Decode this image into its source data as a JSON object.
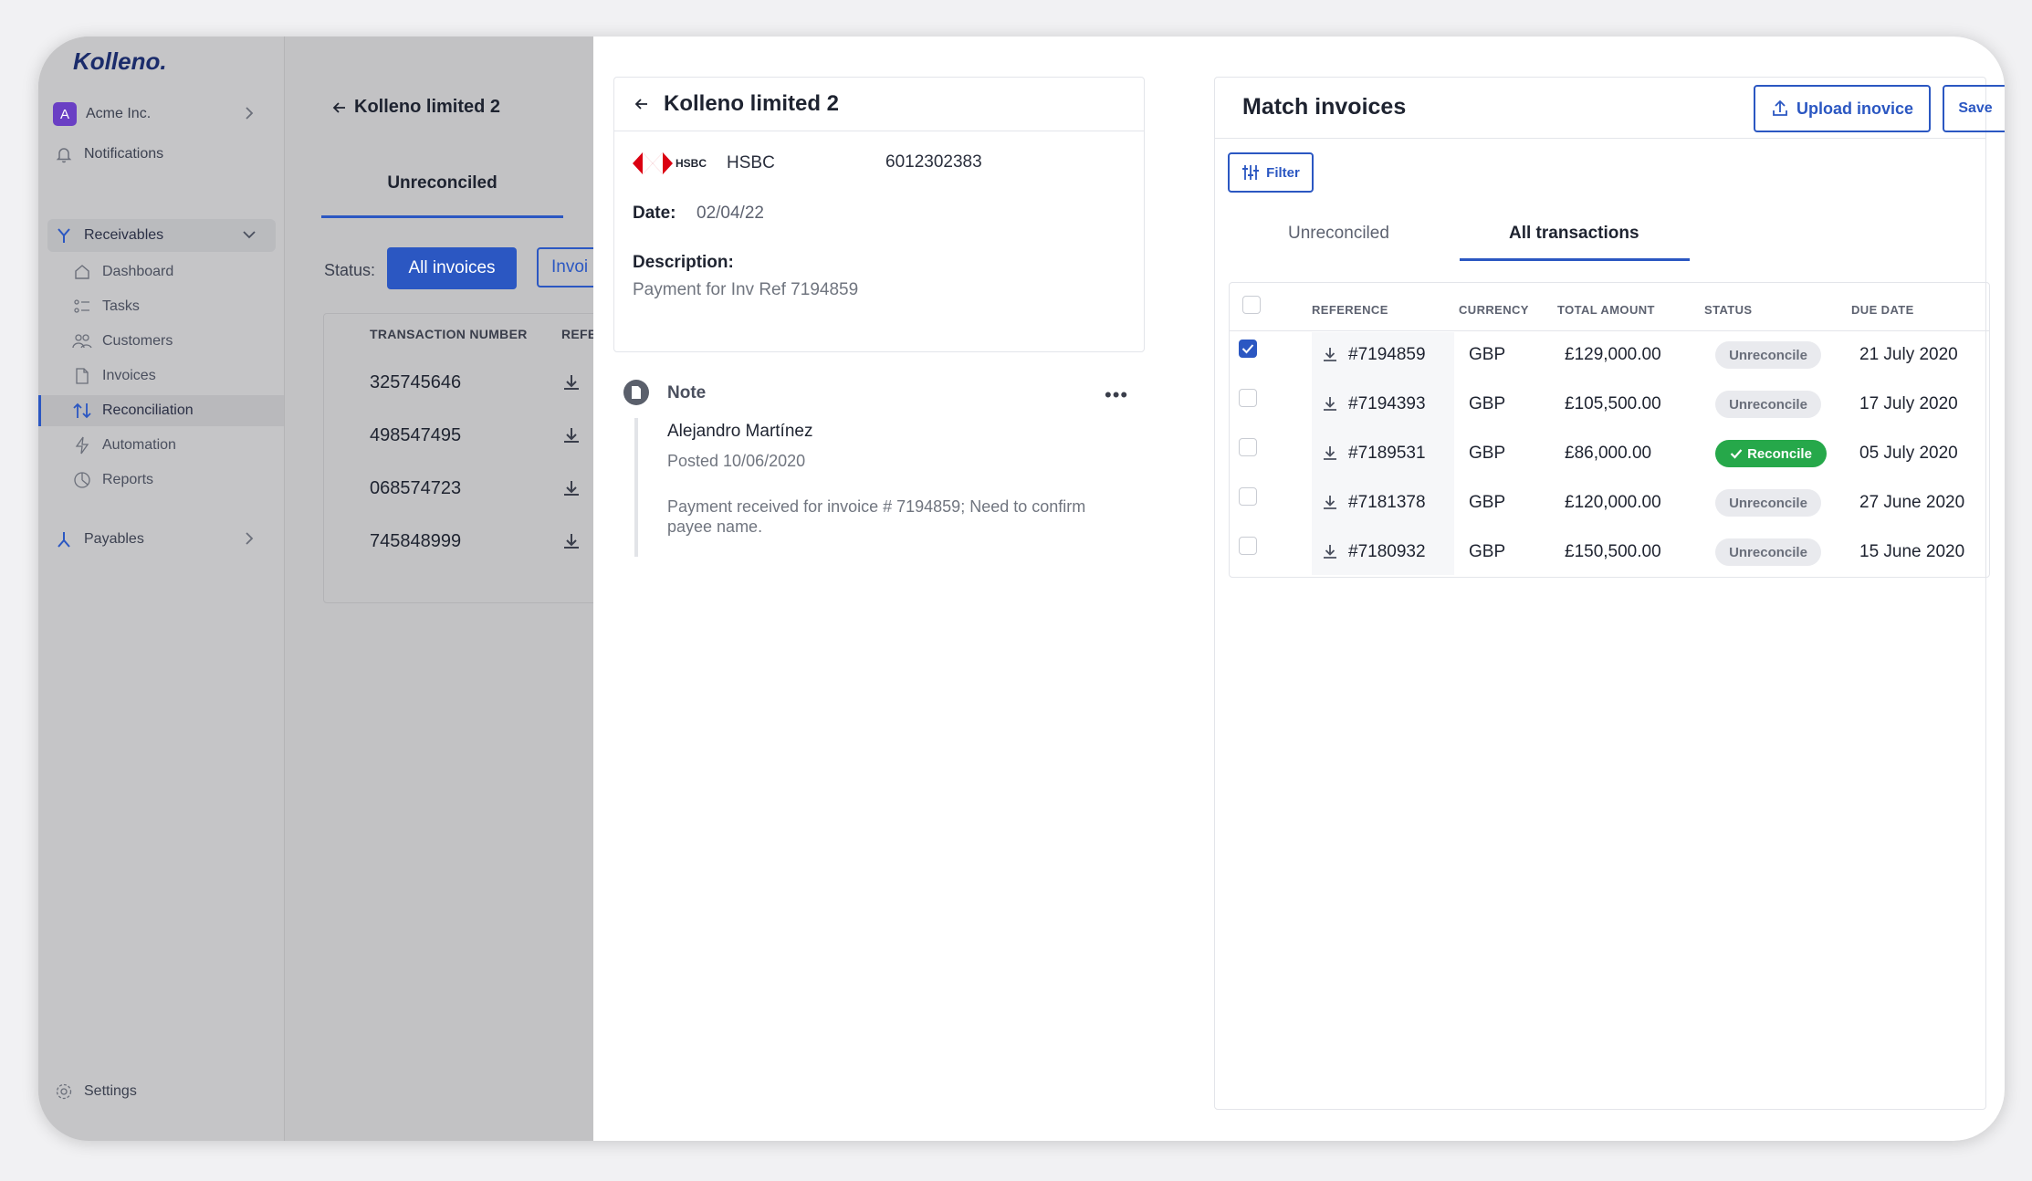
{
  "app": {
    "logo": "Kolleno."
  },
  "sidebar": {
    "org": {
      "badge": "A",
      "name": "Acme Inc."
    },
    "notifications": "Notifications",
    "receivables": {
      "label": "Receivables",
      "items": [
        "Dashboard",
        "Tasks",
        "Customers",
        "Invoices",
        "Reconciliation",
        "Automation",
        "Reports"
      ],
      "active": "Reconciliation"
    },
    "payables": "Payables",
    "settings": "Settings"
  },
  "background_view": {
    "title": "Kolleno limited 2",
    "tab": "Unreconciled",
    "status_label": "Status:",
    "filter_all": "All invoices",
    "filter_second": "Invoi",
    "columns": [
      "TRANSACTION NUMBER",
      "REFE"
    ],
    "rows": [
      "325745646",
      "498547495",
      "068574723",
      "745848999"
    ]
  },
  "transaction": {
    "title": "Kolleno limited 2",
    "bank_logo_text": "HSBC",
    "bank_name": "HSBC",
    "account_number": "6012302383",
    "date_label": "Date:",
    "date_value": "02/04/22",
    "description_label": "Description:",
    "description_value": "Payment for Inv Ref 7194859"
  },
  "note": {
    "label": "Note",
    "menu": "•••",
    "author": "Alejandro Martínez",
    "posted": "Posted 10/06/2020",
    "text": "Payment received for invoice # 7194859; Need to confirm payee name."
  },
  "match": {
    "title": "Match invoices",
    "upload_label": "Upload inovice",
    "save_label": "Save",
    "filter_label": "Filter",
    "tabs": [
      "Unreconciled",
      "All transactions"
    ],
    "active_tab": "All transactions",
    "columns": [
      "REFERENCE",
      "CURRENCY",
      "TOTAL AMOUNT",
      "STATUS",
      "DUE DATE"
    ],
    "rows": [
      {
        "checked": true,
        "reference": "#7194859",
        "currency": "GBP",
        "amount": "£129,000.00",
        "status": "Unreconcile",
        "due": "21 July 2020"
      },
      {
        "checked": false,
        "reference": "#7194393",
        "currency": "GBP",
        "amount": "£105,500.00",
        "status": "Unreconcile",
        "due": "17 July 2020"
      },
      {
        "checked": false,
        "reference": "#7189531",
        "currency": "GBP",
        "amount": "£86,000.00",
        "status": "Reconcile",
        "due": "05 July 2020"
      },
      {
        "checked": false,
        "reference": "#7181378",
        "currency": "GBP",
        "amount": "£120,000.00",
        "status": "Unreconcile",
        "due": "27 June 2020"
      },
      {
        "checked": false,
        "reference": "#7180932",
        "currency": "GBP",
        "amount": "£150,500.00",
        "status": "Unreconcile",
        "due": "15 June 2020"
      }
    ]
  },
  "colors": {
    "accent": "#2b57c2",
    "reconcile": "#26a84a",
    "org_badge": "#6a3fc4",
    "hsbc_red": "#db0011"
  }
}
